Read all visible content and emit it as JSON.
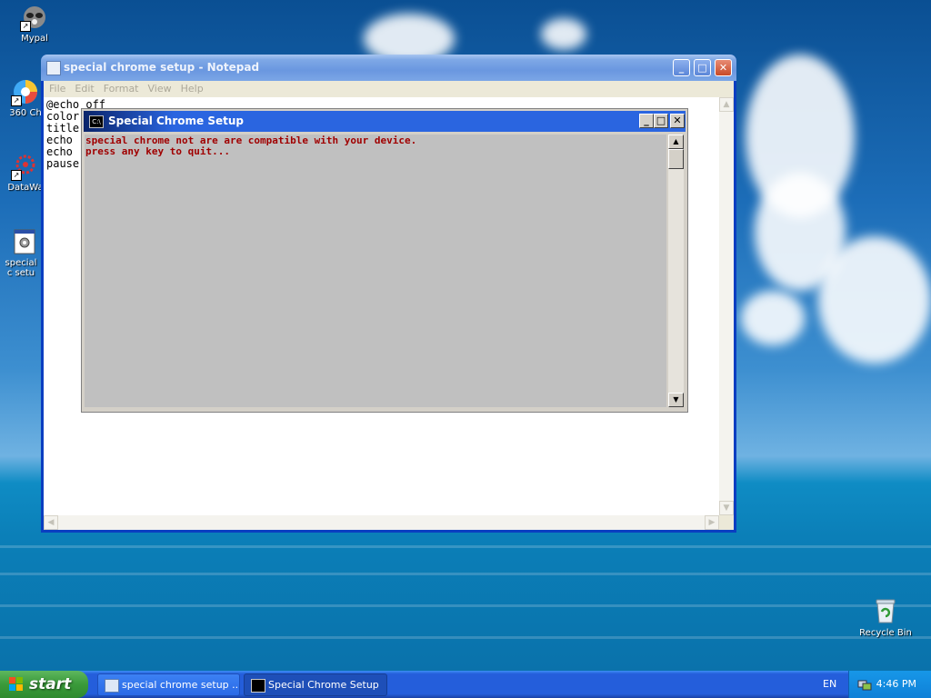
{
  "desktop": {
    "icons": [
      {
        "label": "Mypal"
      },
      {
        "label": "360 Ch"
      },
      {
        "label": "DataWa"
      },
      {
        "label": "special c setu"
      }
    ],
    "recycle_bin": {
      "label": "Recycle Bin"
    }
  },
  "notepad": {
    "title": "special chrome setup - Notepad",
    "menu": [
      "File",
      "Edit",
      "Format",
      "View",
      "Help"
    ],
    "text_lines": [
      "@echo off",
      "color",
      "title",
      "echo",
      "echo",
      "pause"
    ]
  },
  "console": {
    "title": "Special Chrome Setup",
    "icon_text": "C:\\",
    "lines": [
      "special chrome not are are compatible with your device.",
      "press any key to quit..."
    ]
  },
  "taskbar": {
    "start_label": "start",
    "tasks": [
      {
        "label": "special chrome setup ..."
      },
      {
        "label": "Special Chrome Setup"
      }
    ],
    "language": "EN",
    "clock": "4:46 PM"
  }
}
